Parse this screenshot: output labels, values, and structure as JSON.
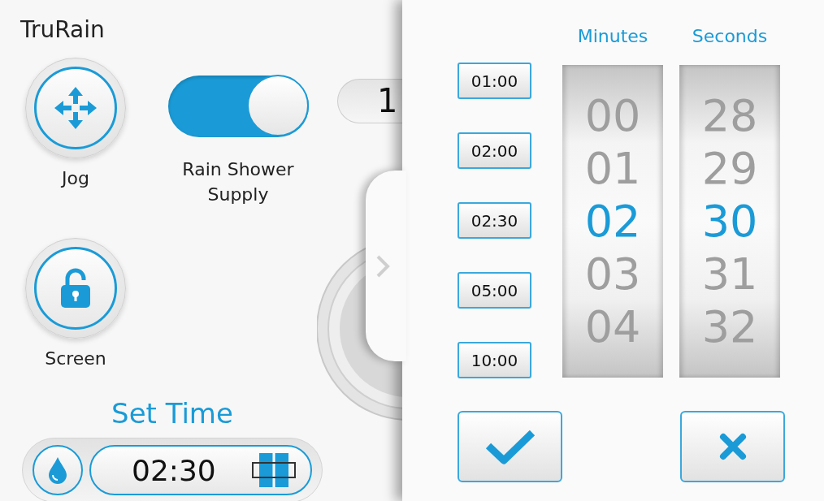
{
  "app_title": "TruRain",
  "round_buttons": [
    {
      "label": "Jog"
    },
    {
      "label": "Screen"
    }
  ],
  "toggle": {
    "label": "Rain Shower Supply",
    "on": true
  },
  "set_time": {
    "title": "Set Time",
    "value": "02:30"
  },
  "covered_panel": {
    "pill_text": "1"
  },
  "presets": [
    "01:00",
    "02:00",
    "02:30",
    "05:00",
    "10:00"
  ],
  "picker": {
    "columns": [
      {
        "heading": "Minutes",
        "values": [
          {
            "text": "00",
            "selected": false
          },
          {
            "text": "01",
            "selected": false
          },
          {
            "text": "02",
            "selected": true
          },
          {
            "text": "03",
            "selected": false
          },
          {
            "text": "04",
            "selected": false
          }
        ]
      },
      {
        "heading": "Seconds",
        "values": [
          {
            "text": "28",
            "selected": false
          },
          {
            "text": "29",
            "selected": false
          },
          {
            "text": "30",
            "selected": true
          },
          {
            "text": "31",
            "selected": false
          },
          {
            "text": "32",
            "selected": false
          }
        ]
      }
    ]
  }
}
